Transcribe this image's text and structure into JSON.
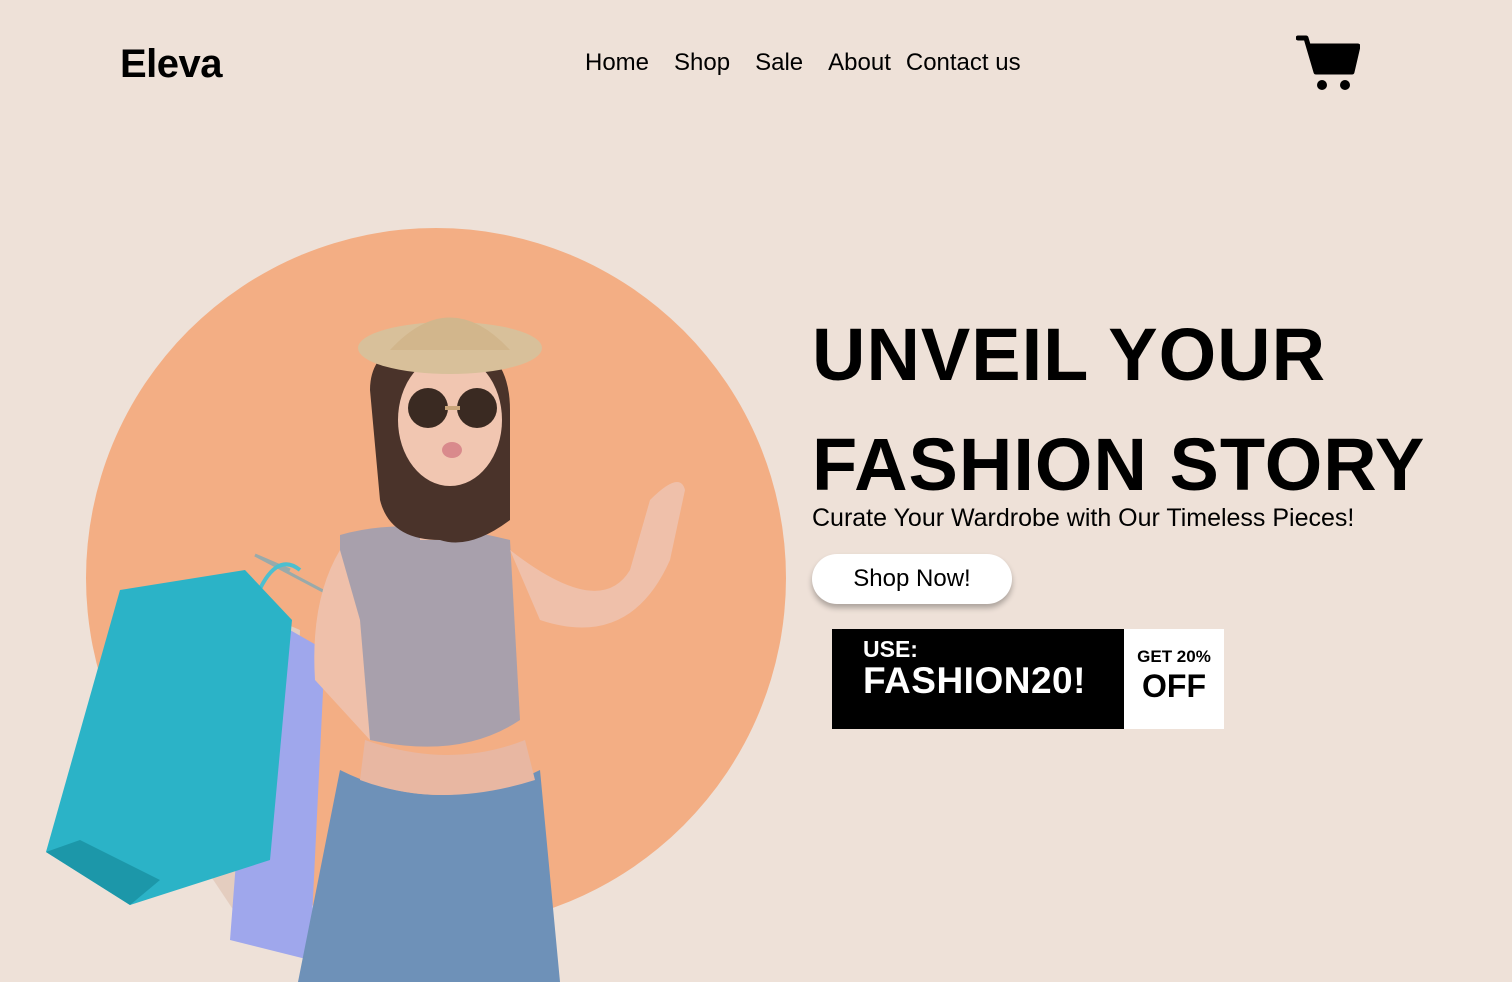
{
  "header": {
    "logo": "Eleva",
    "nav": [
      "Home",
      "Shop",
      "Sale",
      "About",
      "Contact us"
    ],
    "cart_icon": "cart-icon"
  },
  "hero": {
    "headline_line1": "UNVEIL YOUR",
    "headline_line2": "FASHION STORY",
    "subheadline": "Curate Your Wardrobe with Our Timeless Pieces!",
    "cta_label": "Shop Now!",
    "image_alt": "woman-with-shopping-bags"
  },
  "promo": {
    "use_label": "USE:",
    "code": "FASHION20!",
    "offer_line1": "GET 20%",
    "offer_line2": "OFF"
  },
  "colors": {
    "background": "#EEE1D8",
    "circle": "#F3AE84",
    "text": "#000000",
    "button": "#FFFFFF"
  }
}
